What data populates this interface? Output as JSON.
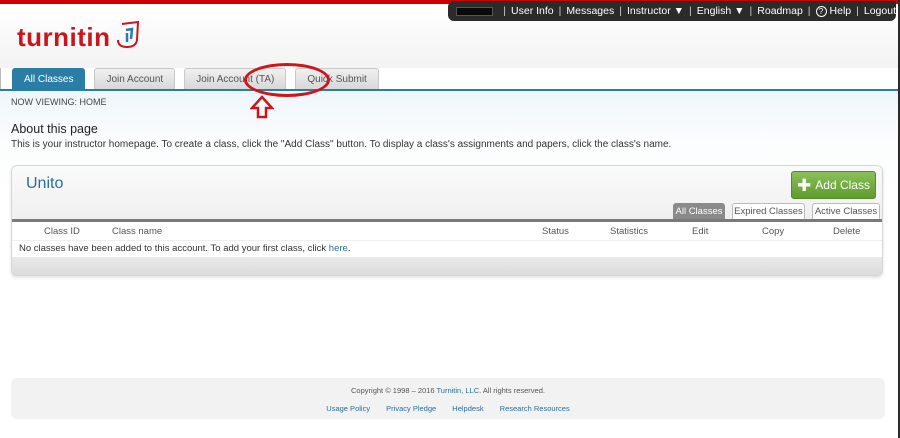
{
  "topnav": {
    "items": [
      "User Info",
      "Messages",
      "Instructor ▼",
      "English ▼",
      "Roadmap",
      "Help",
      "Logout"
    ]
  },
  "logo": {
    "text": "turnitin"
  },
  "tabs": [
    "All Classes",
    "Join Account",
    "Join Account (TA)",
    "Quick Submit"
  ],
  "breadcrumb": "NOW VIEWING: HOME",
  "about": {
    "title": "About this page",
    "description": "This is your instructor homepage. To create a class, click the \"Add Class\" button. To display a class's assignments and papers, click the class's name."
  },
  "panel": {
    "title": "Unito",
    "add_button": "Add Class",
    "filters": [
      "All Classes",
      "Expired Classes",
      "Active Classes"
    ],
    "columns": [
      "Class ID",
      "Class name",
      "Status",
      "Statistics",
      "Edit",
      "Copy",
      "Delete"
    ],
    "empty_text": "No classes have been added to this account. To add your first class, click",
    "empty_link": "here",
    "empty_end": "."
  },
  "footer": {
    "copyright_prefix": "Copyright © 1998 – 2016",
    "copyright_link": "Turnitin, LLC",
    "copyright_suffix": ". All rights reserved.",
    "links": [
      "Usage Policy",
      "Privacy Pledge",
      "Helpdesk",
      "Research Resources"
    ]
  },
  "colors": {
    "brand_red": "#c8161d",
    "tab_active": "#2a7ea6",
    "add_green": "#6fac3c",
    "annotation_red": "#d0141b"
  }
}
